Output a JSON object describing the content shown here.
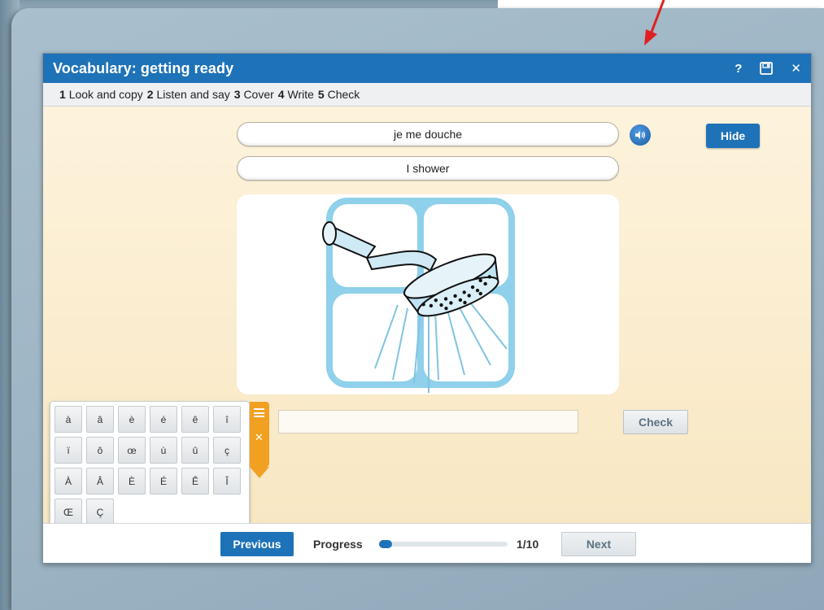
{
  "window": {
    "title": "Vocabulary: getting ready",
    "help_label": "?",
    "close_label": "✕"
  },
  "steps": [
    {
      "num": "1",
      "label": "Look and copy"
    },
    {
      "num": "2",
      "label": "Listen and say"
    },
    {
      "num": "3",
      "label": "Cover"
    },
    {
      "num": "4",
      "label": "Write"
    },
    {
      "num": "5",
      "label": "Check"
    }
  ],
  "word": {
    "french": "je me douche",
    "english": "I shower",
    "image": "shower-head-icon"
  },
  "buttons": {
    "hide": "Hide",
    "check": "Check",
    "previous": "Previous",
    "next": "Next"
  },
  "answer": {
    "value": "",
    "placeholder": ""
  },
  "keyboard": {
    "keys": [
      "à",
      "â",
      "è",
      "é",
      "ê",
      "î",
      "ï",
      "ô",
      "œ",
      "ù",
      "û",
      "ç",
      "À",
      "Â",
      "È",
      "É",
      "Ê",
      "Î",
      "Œ",
      "Ç"
    ]
  },
  "progress": {
    "label": "Progress",
    "current": 1,
    "total": 10,
    "text": "1/10",
    "fraction": 0.1
  },
  "colors": {
    "accent": "#1e72b8",
    "keyboard_tab": "#f2a021",
    "content_bg": "#fbf1d8",
    "annotation_arrow": "#e02020"
  }
}
